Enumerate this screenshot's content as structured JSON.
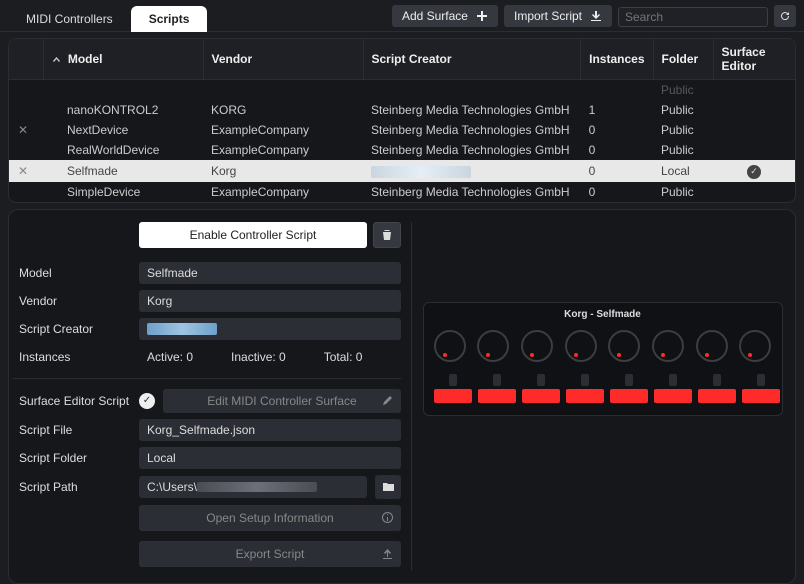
{
  "tabs": {
    "midi": "MIDI Controllers",
    "scripts": "Scripts"
  },
  "topbar": {
    "add_surface": "Add Surface",
    "import_script": "Import Script",
    "search_placeholder": "Search"
  },
  "table": {
    "cols": {
      "model": "Model",
      "vendor": "Vendor",
      "creator": "Script Creator",
      "instances": "Instances",
      "folder": "Folder",
      "surface_editor": "Surface Editor"
    },
    "rows": [
      {
        "model": "nanoKONTROL2",
        "vendor": "KORG",
        "creator": "Steinberg Media Technologies GmbH",
        "instances": "1",
        "folder": "Public",
        "icon": "",
        "se": false,
        "selected": false,
        "creatorBlur": false
      },
      {
        "model": "NextDevice",
        "vendor": "ExampleCompany",
        "creator": "Steinberg Media Technologies GmbH",
        "instances": "0",
        "folder": "Public",
        "icon": "x",
        "se": false,
        "selected": false,
        "creatorBlur": false
      },
      {
        "model": "RealWorldDevice",
        "vendor": "ExampleCompany",
        "creator": "Steinberg Media Technologies GmbH",
        "instances": "0",
        "folder": "Public",
        "icon": "",
        "se": false,
        "selected": false,
        "creatorBlur": false
      },
      {
        "model": "Selfmade",
        "vendor": "Korg",
        "creator": "",
        "instances": "0",
        "folder": "Local",
        "icon": "x",
        "se": true,
        "selected": true,
        "creatorBlur": true
      },
      {
        "model": "SimpleDevice",
        "vendor": "ExampleCompany",
        "creator": "Steinberg Media Technologies GmbH",
        "instances": "0",
        "folder": "Public",
        "icon": "",
        "se": false,
        "selected": false,
        "creatorBlur": false
      }
    ],
    "top_cut": {
      "model": "",
      "vendor": "",
      "creator": "",
      "instances": "",
      "folder": "Public"
    }
  },
  "detail": {
    "enable": "Enable Controller Script",
    "labels": {
      "model": "Model",
      "vendor": "Vendor",
      "creator": "Script Creator",
      "instances": "Instances",
      "se_script": "Surface Editor Script",
      "script_file": "Script File",
      "script_folder": "Script Folder",
      "script_path": "Script Path"
    },
    "values": {
      "model": "Selfmade",
      "vendor": "Korg",
      "instances": {
        "active": "Active: 0",
        "inactive": "Inactive: 0",
        "total": "Total: 0"
      },
      "edit_btn": "Edit MIDI Controller Surface",
      "script_file": "Korg_Selfmade.json",
      "script_folder": "Local",
      "script_path": "C:\\Users\\",
      "open_setup": "Open Setup Information",
      "export": "Export Script"
    }
  },
  "surface": {
    "title": "Korg - Selfmade",
    "knobs": 8,
    "faders": 8
  }
}
